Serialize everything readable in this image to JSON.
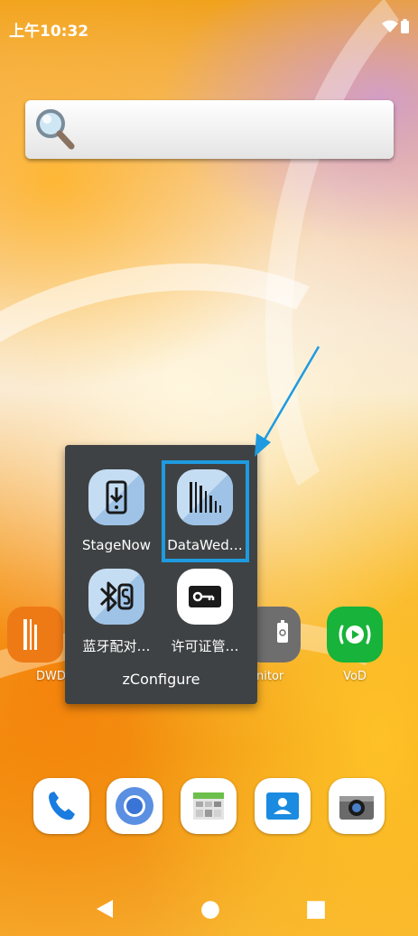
{
  "status_bar": {
    "time": "上午10:32",
    "wifi_icon": "wifi-icon",
    "battery_icon": "battery-icon"
  },
  "search_widget": {
    "icon": "magnifier-icon"
  },
  "home_apps": [
    {
      "label": "DWD",
      "icon": "dwdemo-icon"
    },
    {
      "label": "nitor",
      "icon": "battery-monitor-icon"
    },
    {
      "label": "VoD",
      "icon": "vod-icon"
    }
  ],
  "folder": {
    "name": "zConfigure",
    "items": [
      {
        "label": "StageNow",
        "icon": "stagenow-icon"
      },
      {
        "label": "DataWed…",
        "icon": "datawedge-icon"
      },
      {
        "label": "蓝牙配对…",
        "icon": "bluetooth-pairing-icon"
      },
      {
        "label": "许可证管…",
        "icon": "license-manager-icon"
      }
    ],
    "highlight_color": "#1e9be0"
  },
  "dock": [
    {
      "icon": "phone-icon"
    },
    {
      "icon": "chrome-icon"
    },
    {
      "icon": "calculator-icon"
    },
    {
      "icon": "contacts-icon"
    },
    {
      "icon": "camera-icon"
    }
  ],
  "nav_bar": [
    "back-icon",
    "home-icon",
    "recents-icon"
  ]
}
